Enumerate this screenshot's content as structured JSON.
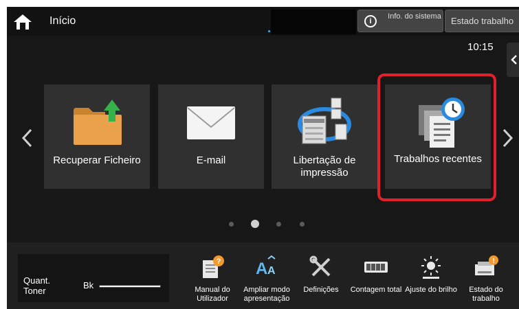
{
  "topbar": {
    "title": "Início",
    "info_label": "Info. do sistema",
    "info_icon": "info-icon",
    "job_status_label": "Estado trabalho"
  },
  "clock": "10:15",
  "tiles": [
    {
      "label": "Recuperar Ficheiro",
      "icon": "folder-retrieve-icon"
    },
    {
      "label": "E-mail",
      "icon": "envelope-icon"
    },
    {
      "label": "Libertação de impressão",
      "icon": "print-release-icon"
    },
    {
      "label": "Trabalhos recentes",
      "icon": "recent-jobs-icon",
      "highlighted": true
    }
  ],
  "pager": {
    "pages": 4,
    "current": 2
  },
  "toner": {
    "label": "Quant. Toner",
    "color_label": "Bk",
    "level": 1.0
  },
  "bottom_buttons": [
    {
      "label": "Manual do Utilizador",
      "icon": "manual-icon"
    },
    {
      "label": "Ampliar modo apresentação",
      "icon": "enlarge-text-icon"
    },
    {
      "label": "Definições",
      "icon": "settings-tools-icon"
    },
    {
      "label": "Contagem total",
      "icon": "counter-icon"
    },
    {
      "label": "Ajuste do brilho",
      "icon": "brightness-icon"
    },
    {
      "label": "Estado do trabalho",
      "icon": "job-status-icon"
    }
  ],
  "colors": {
    "background": "#171717",
    "tile": "#303030",
    "highlight": "#e0202a",
    "accent_blue": "#2a8ae0",
    "folder": "#e9a24a",
    "arrow_green": "#35b24a"
  }
}
